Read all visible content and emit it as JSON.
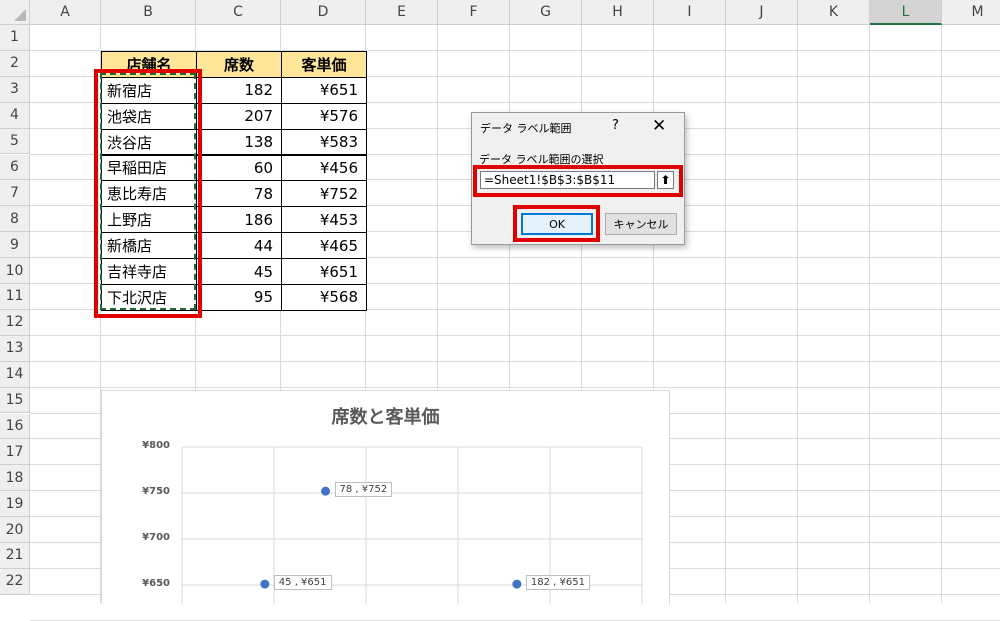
{
  "columns": [
    "A",
    "B",
    "C",
    "D",
    "E",
    "F",
    "G",
    "H",
    "I",
    "J",
    "K",
    "L",
    "M"
  ],
  "rows": [
    "1",
    "2",
    "3",
    "4",
    "5",
    "6",
    "7",
    "8",
    "9",
    "10",
    "11",
    "12",
    "13",
    "14",
    "15",
    "16",
    "17",
    "18",
    "19",
    "20",
    "21",
    "22"
  ],
  "selected_column": "L",
  "table": {
    "headers": [
      "店舗名",
      "席数",
      "客単価"
    ],
    "rows": [
      [
        "新宿店",
        "182",
        "¥651"
      ],
      [
        "池袋店",
        "207",
        "¥576"
      ],
      [
        "渋谷店",
        "138",
        "¥583"
      ],
      [
        "早稲田店",
        "60",
        "¥456"
      ],
      [
        "恵比寿店",
        "78",
        "¥752"
      ],
      [
        "上野店",
        "186",
        "¥453"
      ],
      [
        "新橋店",
        "44",
        "¥465"
      ],
      [
        "吉祥寺店",
        "45",
        "¥651"
      ],
      [
        "下北沢店",
        "95",
        "¥568"
      ]
    ]
  },
  "chart": {
    "title": "席数と客単価",
    "y_ticks": [
      "¥800",
      "¥750",
      "¥700",
      "¥650"
    ],
    "labels": [
      "78 , ¥752",
      "45 , ¥651",
      "182 , ¥651"
    ]
  },
  "chart_data": {
    "type": "scatter",
    "title": "席数と客単価",
    "xlabel": "",
    "ylabel": "",
    "ylim_visible": [
      650,
      800
    ],
    "points": [
      {
        "x": 78,
        "y": 752,
        "label": "78 , ¥752"
      },
      {
        "x": 45,
        "y": 651,
        "label": "45 , ¥651"
      },
      {
        "x": 182,
        "y": 651,
        "label": "182 , ¥651"
      }
    ],
    "grid": true,
    "marker_color": "#4472c4"
  },
  "dialog": {
    "title": "データ ラベル範囲",
    "help": "?",
    "close": "✕",
    "label": "データ ラベル範囲の選択",
    "value": "=Sheet1!$B$3:$B$11",
    "collapse_icon": "⬆",
    "ok": "OK",
    "cancel": "キャンセル"
  },
  "colors": {
    "header_fill": "#ffe699",
    "highlight": "#e10000",
    "marquee": "#1e6b37",
    "accent": "#217346"
  }
}
